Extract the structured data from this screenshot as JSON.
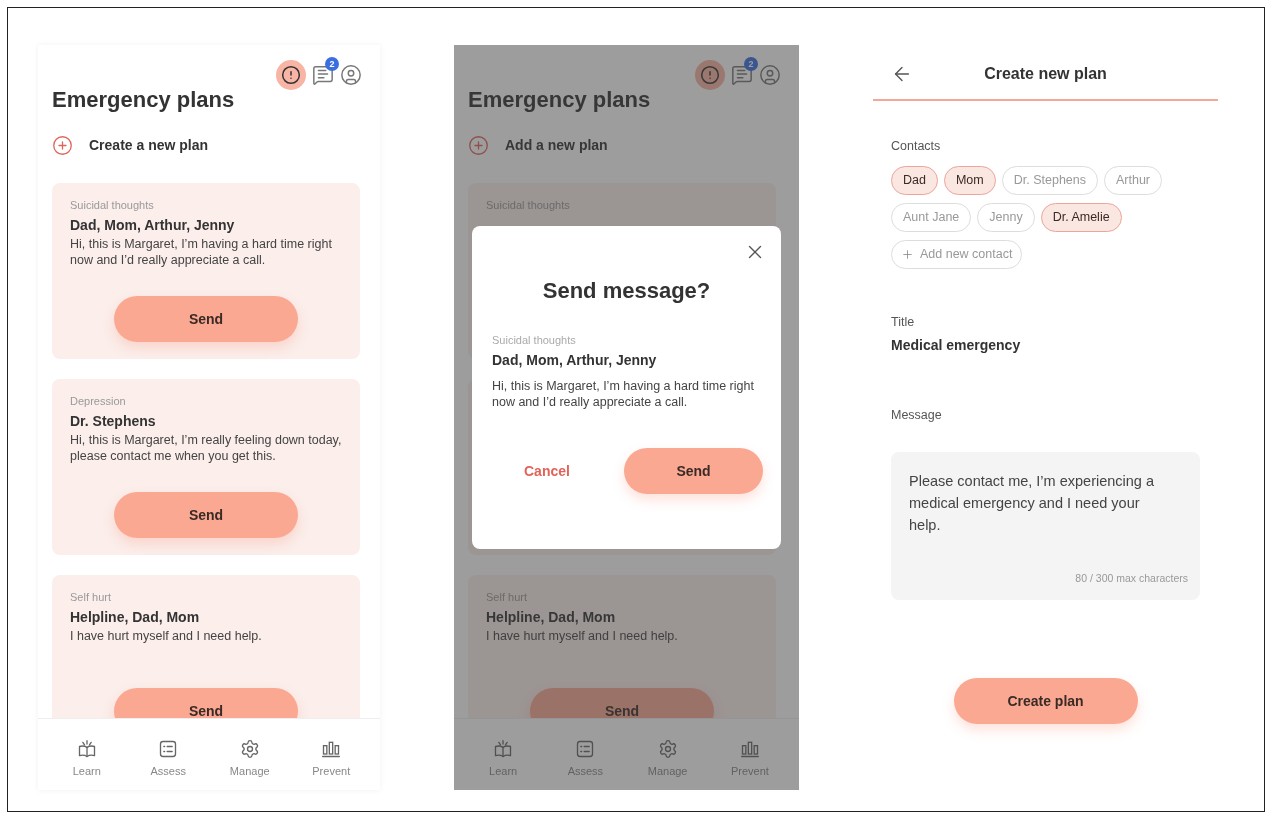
{
  "plans_screen": {
    "title": "Emergency plans",
    "notification_count": "2",
    "create_label": "Create a new plan",
    "plans": [
      {
        "category": "Suicidal thoughts",
        "contacts": "Dad, Mom, Arthur, Jenny",
        "message": "Hi, this is Margaret, I’m having a hard time right now and I’d really appreciate a call.",
        "button": "Send"
      },
      {
        "category": "Depression",
        "contacts": "Dr. Stephens",
        "message": "Hi, this is Margaret, I’m really feeling down today, please contact me when you get this.",
        "button": "Send"
      },
      {
        "category": "Self hurt",
        "contacts": "Helpline, Dad, Mom",
        "message": "I have hurt myself and I need help.",
        "button": "Send"
      }
    ],
    "nav": [
      {
        "label": "Learn"
      },
      {
        "label": "Assess"
      },
      {
        "label": "Manage"
      },
      {
        "label": "Prevent"
      }
    ]
  },
  "dialog_screen": {
    "title": "Emergency plans",
    "notification_count": "2",
    "create_label": "Add a new plan",
    "background_plans": [
      {
        "category": "Suicidal thoughts"
      },
      {
        "category": "Self hurt",
        "contacts": "Helpline, Dad, Mom",
        "message": "I have hurt myself and I need help.",
        "button": "Send"
      }
    ],
    "dialog": {
      "title": "Send message?",
      "category": "Suicidal thoughts",
      "contacts": "Dad, Mom, Arthur, Jenny",
      "message": "Hi, this is Margaret, I’m having a hard time right now and I’d really appreciate a call.",
      "cancel": "Cancel",
      "confirm": "Send"
    },
    "nav": [
      {
        "label": "Learn"
      },
      {
        "label": "Assess"
      },
      {
        "label": "Manage"
      },
      {
        "label": "Prevent"
      }
    ]
  },
  "create_screen": {
    "title": "Create new plan",
    "contacts_label": "Contacts",
    "contacts": [
      {
        "name": "Dad",
        "selected": true
      },
      {
        "name": "Mom",
        "selected": true
      },
      {
        "name": "Dr. Stephens",
        "selected": false
      },
      {
        "name": "Arthur",
        "selected": false
      },
      {
        "name": "Aunt Jane",
        "selected": false
      },
      {
        "name": "Jenny",
        "selected": false
      },
      {
        "name": "Dr. Amelie",
        "selected": true
      }
    ],
    "add_contact_label": "Add new contact",
    "title_label": "Title",
    "title_value": "Medical emergency",
    "message_label": "Message",
    "message_value": "Please contact me, I’m experiencing a medical emergency and I need your help.",
    "counter": "80 / 300 max characters",
    "button": "Create plan"
  }
}
